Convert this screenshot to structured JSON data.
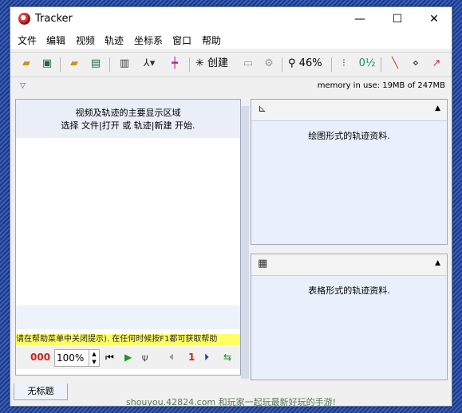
{
  "window": {
    "title": "Tracker"
  },
  "window_controls": {
    "minimize": "—",
    "maximize": "☐",
    "close": "✕"
  },
  "menu": [
    "文件",
    "编辑",
    "视频",
    "轨迹",
    "坐标系",
    "窗口",
    "帮助"
  ],
  "toolbar": {
    "create_label": "创建",
    "zoom_label": "46%"
  },
  "status": {
    "memory": "memory in use: 19MB of 247MB"
  },
  "video_panel": {
    "line1": "视频及轨迹的主要显示区域",
    "line2": "选择 文件|打开 或 轨迹|新建 开始.",
    "hint": "请在帮助菜单中关闭提示). 在任何时候按F1都可获取帮助"
  },
  "player": {
    "frame_counter": "000",
    "rate": "100%",
    "step": "1"
  },
  "plot_panel": {
    "text": "绘图形式的轨迹资料."
  },
  "table_panel": {
    "text": "表格形式的轨迹资料."
  },
  "tab": {
    "label": "无标题"
  },
  "watermark": {
    "text": "shouyou.42824.com 和玩家一起玩最新好玩的手游!"
  }
}
